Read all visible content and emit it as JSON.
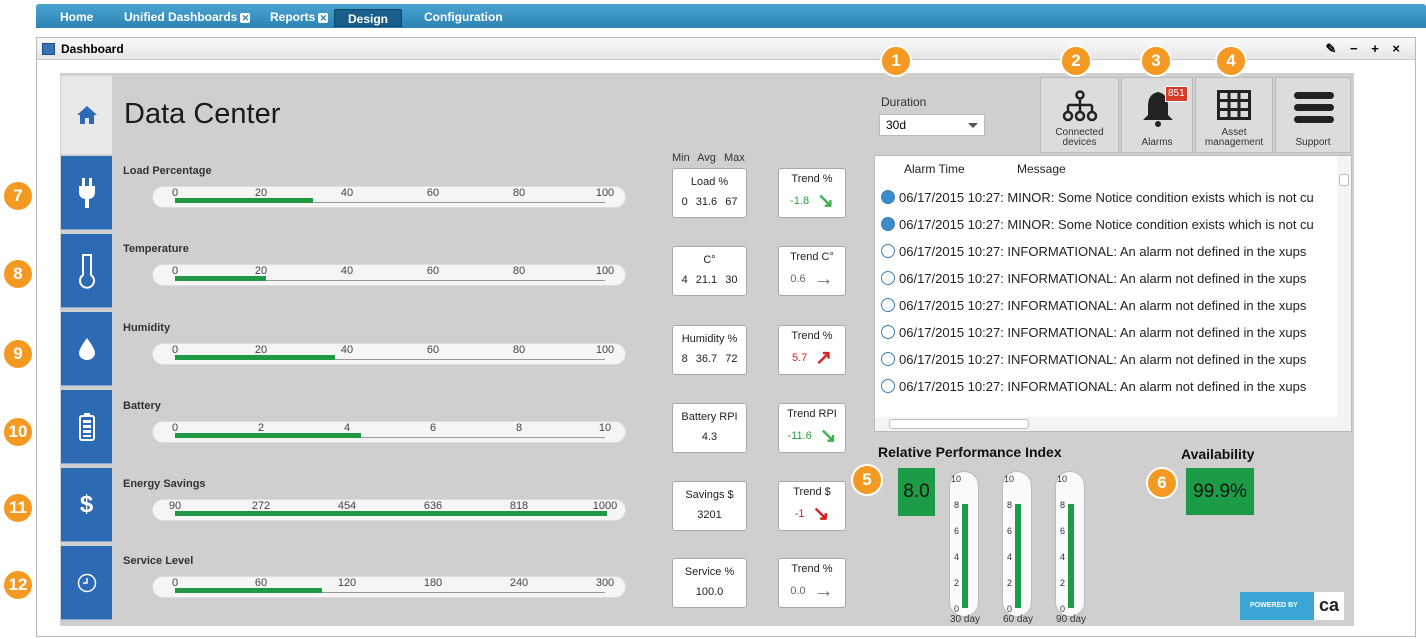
{
  "nav": {
    "tabs": [
      {
        "label": "Home"
      },
      {
        "label": "Unified Dashboards"
      },
      {
        "label": "Reports"
      },
      {
        "label": "Design"
      },
      {
        "label": "Configuration"
      }
    ]
  },
  "panel": {
    "title": "Dashboard",
    "controls": "✎ − + ×"
  },
  "page": {
    "title": "Data Center"
  },
  "header": {
    "min_avg_max": "Min  Avg  Max"
  },
  "gauges": [
    {
      "label": "Load Percentage",
      "ticks": [
        "0",
        "20",
        "40",
        "60",
        "80",
        "100"
      ],
      "fill": 0.32,
      "stat": {
        "title": "Load %",
        "values": "0  31.6  67"
      },
      "trend": {
        "title": "Trend %",
        "value": "-1.8",
        "direction": "down",
        "color": "#2aa13a"
      }
    },
    {
      "label": "Temperature",
      "ticks": [
        "0",
        "20",
        "40",
        "60",
        "80",
        "100"
      ],
      "fill": 0.21,
      "stat": {
        "title": "C°",
        "values": "4  21.1  30"
      },
      "trend": {
        "title": "Trend C°",
        "value": "0.6",
        "direction": "flat",
        "color": "#666666"
      }
    },
    {
      "label": "Humidity",
      "ticks": [
        "0",
        "20",
        "40",
        "60",
        "80",
        "100"
      ],
      "fill": 0.37,
      "stat": {
        "title": "Humidity %",
        "values": "8  36.7  72"
      },
      "trend": {
        "title": "Trend %",
        "value": "5.7",
        "direction": "up",
        "color": "#d42020"
      }
    },
    {
      "label": "Battery",
      "ticks": [
        "0",
        "2",
        "4",
        "6",
        "8",
        "10"
      ],
      "fill": 0.43,
      "stat": {
        "title": "Battery RPI",
        "values": "4.3"
      },
      "trend": {
        "title": "Trend RPI",
        "value": "-11.6",
        "direction": "down",
        "color": "#2aa13a"
      }
    },
    {
      "label": "Energy Savings",
      "ticks": [
        "90",
        "272",
        "454",
        "636",
        "818",
        "1000"
      ],
      "fill": 1.0,
      "stat": {
        "title": "Savings $",
        "values": "3201"
      },
      "trend": {
        "title": "Trend $",
        "value": "-1",
        "direction": "down",
        "color": "#d42020"
      }
    },
    {
      "label": "Service Level",
      "ticks": [
        "0",
        "60",
        "120",
        "180",
        "240",
        "300"
      ],
      "fill": 0.34,
      "stat": {
        "title": "Service %",
        "values": "100.0"
      },
      "trend": {
        "title": "Trend %",
        "value": "0.0",
        "direction": "flat",
        "color": "#666666"
      }
    }
  ],
  "duration": {
    "label": "Duration",
    "value": "30d"
  },
  "toolbar": [
    {
      "label": "Connected devices",
      "icon": "connected-devices-icon"
    },
    {
      "label": "Alarms",
      "icon": "bell-icon",
      "badge": "851"
    },
    {
      "label": "Asset management",
      "icon": "grid-icon"
    },
    {
      "label": "Support",
      "icon": "menu-icon"
    }
  ],
  "callouts": [
    "1",
    "2",
    "3",
    "4",
    "5",
    "6",
    "7",
    "8",
    "9",
    "10",
    "11",
    "12"
  ],
  "alarms": {
    "columns": [
      "Alarm Time",
      "Message"
    ],
    "rows": [
      {
        "text": "06/17/2015 10:27: MINOR: Some Notice condition exists which is not cu",
        "filled": true
      },
      {
        "text": "06/17/2015 10:27: MINOR: Some Notice condition exists which is not cu",
        "filled": true
      },
      {
        "text": "06/17/2015 10:27: INFORMATIONAL: An alarm not defined in the xups",
        "filled": false
      },
      {
        "text": "06/17/2015 10:27: INFORMATIONAL: An alarm not defined in the xups",
        "filled": false
      },
      {
        "text": "06/17/2015 10:27: INFORMATIONAL: An alarm not defined in the xups",
        "filled": false
      },
      {
        "text": "06/17/2015 10:27: INFORMATIONAL: An alarm not defined in the xups",
        "filled": false
      },
      {
        "text": "06/17/2015 10:27: INFORMATIONAL: An alarm not defined in the xups",
        "filled": false
      },
      {
        "text": "06/17/2015 10:27: INFORMATIONAL: An alarm not defined in the xups",
        "filled": false
      }
    ]
  },
  "rpi": {
    "title": "Relative Performance Index",
    "value": "8.0",
    "thermometers": [
      {
        "label": "30 day",
        "level": 0.8
      },
      {
        "label": "60 day",
        "level": 0.8
      },
      {
        "label": "90 day",
        "level": 0.8
      }
    ],
    "scale": [
      "10",
      "8",
      "6",
      "4",
      "2",
      "0"
    ]
  },
  "availability": {
    "title": "Availability",
    "value": "99.9%"
  },
  "footer": {
    "powered": "POWERED BY",
    "logo": "ca"
  }
}
